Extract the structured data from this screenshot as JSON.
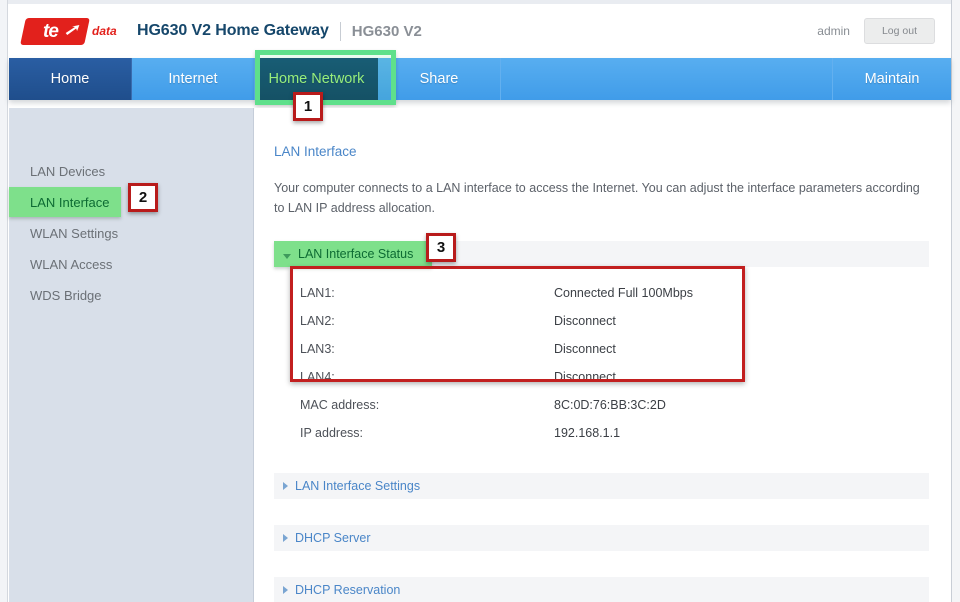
{
  "header": {
    "logo_text": "te",
    "logo_suffix": "data",
    "title": "HG630 V2 Home Gateway",
    "model": "HG630 V2",
    "user": "admin",
    "logout_label": "Log out"
  },
  "nav": {
    "items": [
      {
        "label": "Home",
        "state": "visited"
      },
      {
        "label": "Internet",
        "state": "normal"
      },
      {
        "label": "Home Network",
        "state": "active"
      },
      {
        "label": "Share",
        "state": "normal"
      },
      {
        "label": "Maintain",
        "state": "normal"
      }
    ]
  },
  "sidebar": {
    "items": [
      {
        "label": "LAN Devices",
        "active": false
      },
      {
        "label": "LAN Interface",
        "active": true
      },
      {
        "label": "WLAN Settings",
        "active": false
      },
      {
        "label": "WLAN Access",
        "active": false
      },
      {
        "label": "WDS Bridge",
        "active": false
      }
    ]
  },
  "main": {
    "page_title": "LAN Interface",
    "description": "Your computer connects to a LAN interface to access the Internet. You can adjust the interface parameters according to LAN IP address allocation.",
    "status_section": {
      "label": "LAN Interface Status",
      "expanded": true,
      "rows": [
        {
          "key": "LAN1:",
          "value": "Connected Full 100Mbps"
        },
        {
          "key": "LAN2:",
          "value": "Disconnect"
        },
        {
          "key": "LAN3:",
          "value": "Disconnect"
        },
        {
          "key": "LAN4:",
          "value": "Disconnect"
        },
        {
          "key": "MAC address:",
          "value": "8C:0D:76:BB:3C:2D"
        },
        {
          "key": "IP address:",
          "value": "192.168.1.1"
        }
      ]
    },
    "collapsed_sections": [
      {
        "label": "LAN Interface Settings"
      },
      {
        "label": "DHCP Server"
      },
      {
        "label": "DHCP Reservation"
      }
    ]
  },
  "annotations": {
    "badges": [
      {
        "number": "1",
        "target": "nav-home-network"
      },
      {
        "number": "2",
        "target": "sidebar-lan-interface"
      },
      {
        "number": "3",
        "target": "lan-interface-status-section"
      }
    ],
    "highlight_color": "#7ee08b",
    "box_color": "#c21f1f"
  }
}
